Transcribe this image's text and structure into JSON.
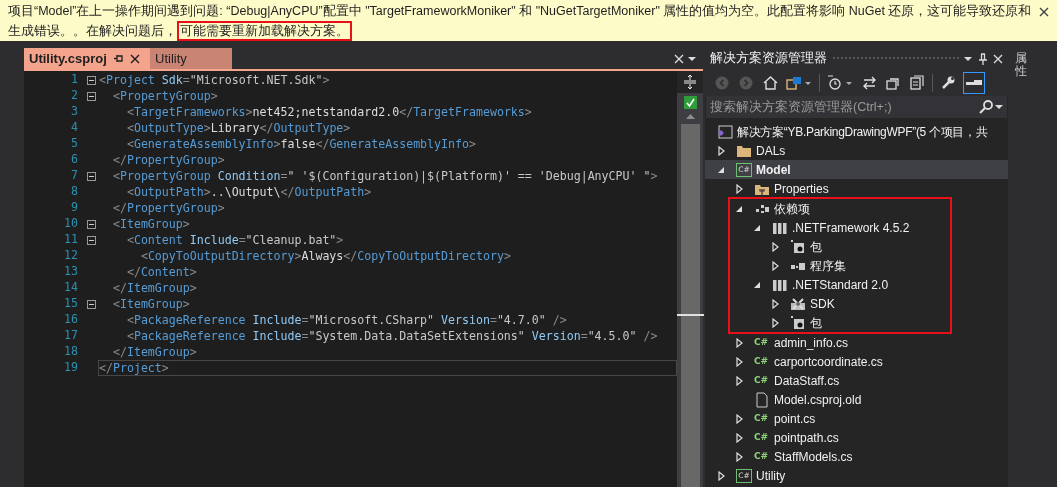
{
  "info_bar": {
    "lines": [
      [
        {
          "text": "项目“Model”在上一操作期间遇到问题: “Debug|AnyCPU”配置中 \"TargetFrameworkMoniker\" 和 \"NuGetTargetMoniker\" 属性的值均为空。此配置将影响 NuGet 还原，这可能导致还原和",
          "highlighted": false
        }
      ],
      [
        {
          "text": "生成错误。。在解决问题后，",
          "highlighted": false
        },
        {
          "text": "可能需要重新加载解决方案。",
          "highlighted": true
        }
      ]
    ]
  },
  "editor": {
    "tabs": [
      {
        "label": "Utility.csproj",
        "selected": true
      },
      {
        "label": "Utility",
        "selected": false
      }
    ],
    "lines": [
      {
        "number": "1",
        "foldable": true,
        "current": false,
        "tokens": [
          {
            "kind": "bracket",
            "text": "<"
          },
          {
            "kind": "tag",
            "text": "Project"
          },
          {
            "kind": "attr",
            "text": " Sdk"
          },
          {
            "kind": "bracket",
            "text": "="
          },
          {
            "kind": "value",
            "text": "\"Microsoft.NET.Sdk\""
          },
          {
            "kind": "bracket",
            "text": ">"
          }
        ]
      },
      {
        "number": "2",
        "foldable": true,
        "current": false,
        "tokens": [
          {
            "kind": "bracket",
            "text": "  <"
          },
          {
            "kind": "tag",
            "text": "PropertyGroup"
          },
          {
            "kind": "bracket",
            "text": ">"
          }
        ]
      },
      {
        "number": "3",
        "foldable": false,
        "current": false,
        "tokens": [
          {
            "kind": "bracket",
            "text": "    <"
          },
          {
            "kind": "tag",
            "text": "TargetFrameworks"
          },
          {
            "kind": "bracket",
            "text": ">"
          },
          {
            "kind": "text",
            "text": "net452;netstandard2.0"
          },
          {
            "kind": "bracket",
            "text": "</"
          },
          {
            "kind": "tag",
            "text": "TargetFrameworks"
          },
          {
            "kind": "bracket",
            "text": ">"
          }
        ]
      },
      {
        "number": "4",
        "foldable": false,
        "current": false,
        "tokens": [
          {
            "kind": "bracket",
            "text": "    <"
          },
          {
            "kind": "tag",
            "text": "OutputType"
          },
          {
            "kind": "bracket",
            "text": ">"
          },
          {
            "kind": "text",
            "text": "Library"
          },
          {
            "kind": "bracket",
            "text": "</"
          },
          {
            "kind": "tag",
            "text": "OutputType"
          },
          {
            "kind": "bracket",
            "text": ">"
          }
        ]
      },
      {
        "number": "5",
        "foldable": false,
        "current": false,
        "tokens": [
          {
            "kind": "bracket",
            "text": "    <"
          },
          {
            "kind": "tag",
            "text": "GenerateAssemblyInfo"
          },
          {
            "kind": "bracket",
            "text": ">"
          },
          {
            "kind": "text",
            "text": "false"
          },
          {
            "kind": "bracket",
            "text": "</"
          },
          {
            "kind": "tag",
            "text": "GenerateAssemblyInfo"
          },
          {
            "kind": "bracket",
            "text": ">"
          }
        ]
      },
      {
        "number": "6",
        "foldable": false,
        "current": false,
        "tokens": [
          {
            "kind": "bracket",
            "text": "  </"
          },
          {
            "kind": "tag",
            "text": "PropertyGroup"
          },
          {
            "kind": "bracket",
            "text": ">"
          }
        ]
      },
      {
        "number": "7",
        "foldable": true,
        "current": false,
        "tokens": [
          {
            "kind": "bracket",
            "text": "  <"
          },
          {
            "kind": "tag",
            "text": "PropertyGroup"
          },
          {
            "kind": "attr",
            "text": " Condition"
          },
          {
            "kind": "bracket",
            "text": "="
          },
          {
            "kind": "value",
            "text": "\" '$(Configuration)|$(Platform)' == 'Debug|AnyCPU' \""
          },
          {
            "kind": "bracket",
            "text": ">"
          }
        ]
      },
      {
        "number": "8",
        "foldable": false,
        "current": false,
        "tokens": [
          {
            "kind": "bracket",
            "text": "    <"
          },
          {
            "kind": "tag",
            "text": "OutputPath"
          },
          {
            "kind": "bracket",
            "text": ">"
          },
          {
            "kind": "text",
            "text": "..\\Output\\"
          },
          {
            "kind": "bracket",
            "text": "</"
          },
          {
            "kind": "tag",
            "text": "OutputPath"
          },
          {
            "kind": "bracket",
            "text": ">"
          }
        ]
      },
      {
        "number": "9",
        "foldable": false,
        "current": false,
        "tokens": [
          {
            "kind": "bracket",
            "text": "  </"
          },
          {
            "kind": "tag",
            "text": "PropertyGroup"
          },
          {
            "kind": "bracket",
            "text": ">"
          }
        ]
      },
      {
        "number": "10",
        "foldable": true,
        "current": false,
        "tokens": [
          {
            "kind": "bracket",
            "text": "  <"
          },
          {
            "kind": "tag",
            "text": "ItemGroup"
          },
          {
            "kind": "bracket",
            "text": ">"
          }
        ]
      },
      {
        "number": "11",
        "foldable": true,
        "current": false,
        "tokens": [
          {
            "kind": "bracket",
            "text": "    <"
          },
          {
            "kind": "tag",
            "text": "Content"
          },
          {
            "kind": "attr",
            "text": " Include"
          },
          {
            "kind": "bracket",
            "text": "="
          },
          {
            "kind": "value",
            "text": "\"Cleanup.bat\""
          },
          {
            "kind": "bracket",
            "text": ">"
          }
        ]
      },
      {
        "number": "12",
        "foldable": false,
        "current": false,
        "tokens": [
          {
            "kind": "bracket",
            "text": "      <"
          },
          {
            "kind": "tag",
            "text": "CopyToOutputDirectory"
          },
          {
            "kind": "bracket",
            "text": ">"
          },
          {
            "kind": "text",
            "text": "Always"
          },
          {
            "kind": "bracket",
            "text": "</"
          },
          {
            "kind": "tag",
            "text": "CopyToOutputDirectory"
          },
          {
            "kind": "bracket",
            "text": ">"
          }
        ]
      },
      {
        "number": "13",
        "foldable": false,
        "current": false,
        "tokens": [
          {
            "kind": "bracket",
            "text": "    </"
          },
          {
            "kind": "tag",
            "text": "Content"
          },
          {
            "kind": "bracket",
            "text": ">"
          }
        ]
      },
      {
        "number": "14",
        "foldable": false,
        "current": false,
        "tokens": [
          {
            "kind": "bracket",
            "text": "  </"
          },
          {
            "kind": "tag",
            "text": "ItemGroup"
          },
          {
            "kind": "bracket",
            "text": ">"
          }
        ]
      },
      {
        "number": "15",
        "foldable": true,
        "current": false,
        "tokens": [
          {
            "kind": "bracket",
            "text": "  <"
          },
          {
            "kind": "tag",
            "text": "ItemGroup"
          },
          {
            "kind": "bracket",
            "text": ">"
          }
        ]
      },
      {
        "number": "16",
        "foldable": false,
        "current": false,
        "tokens": [
          {
            "kind": "bracket",
            "text": "    <"
          },
          {
            "kind": "tag",
            "text": "PackageReference"
          },
          {
            "kind": "attr",
            "text": " Include"
          },
          {
            "kind": "bracket",
            "text": "="
          },
          {
            "kind": "value",
            "text": "\"Microsoft.CSharp\""
          },
          {
            "kind": "attr",
            "text": " Version"
          },
          {
            "kind": "bracket",
            "text": "="
          },
          {
            "kind": "value",
            "text": "\"4.7.0\""
          },
          {
            "kind": "bracket",
            "text": " />"
          }
        ]
      },
      {
        "number": "17",
        "foldable": false,
        "current": false,
        "tokens": [
          {
            "kind": "bracket",
            "text": "    <"
          },
          {
            "kind": "tag",
            "text": "PackageReference"
          },
          {
            "kind": "attr",
            "text": " Include"
          },
          {
            "kind": "bracket",
            "text": "="
          },
          {
            "kind": "value",
            "text": "\"System.Data.DataSetExtensions\""
          },
          {
            "kind": "attr",
            "text": " Version"
          },
          {
            "kind": "bracket",
            "text": "="
          },
          {
            "kind": "value",
            "text": "\"4.5.0\""
          },
          {
            "kind": "bracket",
            "text": " />"
          }
        ]
      },
      {
        "number": "18",
        "foldable": false,
        "current": false,
        "tokens": [
          {
            "kind": "bracket",
            "text": "  </"
          },
          {
            "kind": "tag",
            "text": "ItemGroup"
          },
          {
            "kind": "bracket",
            "text": ">"
          }
        ]
      },
      {
        "number": "19",
        "foldable": false,
        "current": true,
        "tokens": [
          {
            "kind": "bracket",
            "text": "</"
          },
          {
            "kind": "tag",
            "text": "Project"
          },
          {
            "kind": "bracket",
            "text": ">"
          }
        ]
      }
    ]
  },
  "solution_explorer": {
    "title": "解决方案资源管理器",
    "search": {
      "placeholder": "搜索解决方案资源管理器(Ctrl+;)"
    },
    "solution": {
      "label": "解决方案“YB.ParkingDrawingWPF”(5 个项目，共"
    },
    "items": [
      {
        "label": "DALs",
        "kind": "folder",
        "expanded": false,
        "selected": false
      },
      {
        "label": "Model",
        "kind": "project",
        "icon_label": "C#",
        "expanded": true,
        "selected": true,
        "children": [
          {
            "label": "Properties",
            "kind": "properties",
            "expanded": false,
            "selected": false
          },
          {
            "label": "依赖项",
            "kind": "dependencies",
            "expanded": true,
            "selected": false,
            "highlighted": true,
            "children": [
              {
                "label": ".NETFramework 4.5.2",
                "kind": "framework",
                "expanded": true,
                "selected": false,
                "children": [
                  {
                    "label": "包",
                    "kind": "package",
                    "expanded": false,
                    "selected": false
                  },
                  {
                    "label": "程序集",
                    "kind": "assembly",
                    "expanded": false,
                    "selected": false
                  }
                ]
              },
              {
                "label": ".NETStandard 2.0",
                "kind": "framework",
                "expanded": true,
                "selected": false,
                "children": [
                  {
                    "label": "SDK",
                    "kind": "sdk",
                    "expanded": false,
                    "selected": false
                  },
                  {
                    "label": "包",
                    "kind": "package",
                    "expanded": false,
                    "selected": false
                  }
                ]
              }
            ]
          },
          {
            "label": "admin_info.cs",
            "kind": "code_file",
            "icon_label": "C#",
            "expanded": false,
            "selected": false
          },
          {
            "label": "carportcoordinate.cs",
            "kind": "code_file",
            "icon_label": "C#",
            "expanded": false,
            "selected": false
          },
          {
            "label": "DataStaff.cs",
            "kind": "code_file",
            "icon_label": "C#",
            "expanded": false,
            "selected": false
          },
          {
            "label": "Model.csproj.old",
            "kind": "file",
            "selected": false
          },
          {
            "label": "point.cs",
            "kind": "code_file",
            "icon_label": "C#",
            "expanded": false,
            "selected": false
          },
          {
            "label": "pointpath.cs",
            "kind": "code_file",
            "icon_label": "C#",
            "expanded": false,
            "selected": false
          },
          {
            "label": "StaffModels.cs",
            "kind": "code_file",
            "icon_label": "C#",
            "expanded": false,
            "selected": false
          }
        ]
      },
      {
        "label": "Utility",
        "kind": "project",
        "icon_label": "C#",
        "expanded": false,
        "selected": false
      }
    ]
  },
  "side_tab": {
    "label": "属性"
  }
}
